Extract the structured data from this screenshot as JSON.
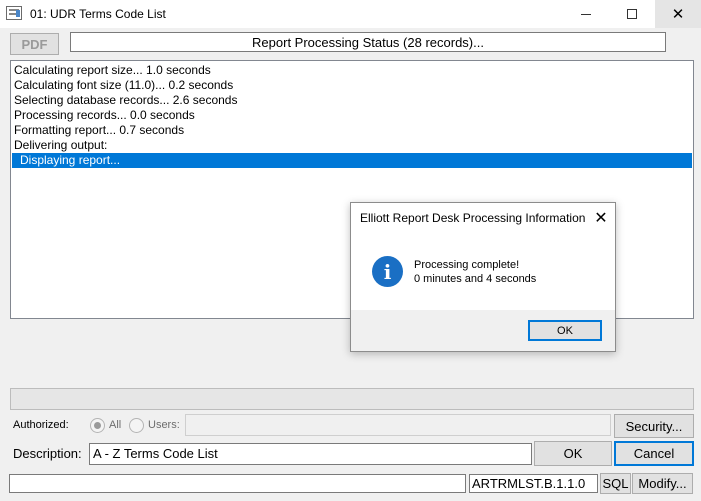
{
  "window": {
    "title": "01: UDR Terms Code List",
    "app_icon": "report-window-icon",
    "close_glyph": "✕"
  },
  "toolbar": {
    "pdf_label": "PDF",
    "status_text": "Report Processing Status (28 records)..."
  },
  "log": {
    "lines": [
      "Calculating report size...  1.0 seconds",
      "Calculating font size (11.0)...  0.2 seconds",
      "Selecting database records...  2.6 seconds",
      "Processing records...  0.0 seconds",
      "Formatting report...  0.7 seconds",
      "Delivering output:"
    ],
    "selected_line": "Displaying report...",
    "selection_color": "#0078d7"
  },
  "dialog": {
    "title": "Elliott Report Desk Processing Information",
    "close_glyph": "✕",
    "icon": "info-icon",
    "message_line1": "Processing complete!",
    "message_line2": "0 minutes and 4 seconds",
    "ok_label": "OK"
  },
  "authorized": {
    "label": "Authorized:",
    "option_all": "All",
    "option_users": "Users:",
    "selected": "All",
    "security_label": "Security..."
  },
  "description": {
    "label": "Description:",
    "value": "A - Z Terms Code List",
    "ok_label": "OK",
    "cancel_label": "Cancel"
  },
  "footer": {
    "left_value": "",
    "code_value": "ARTRMLST.B.1.1.0",
    "sql_label": "SQL",
    "modify_label": "Modify..."
  }
}
